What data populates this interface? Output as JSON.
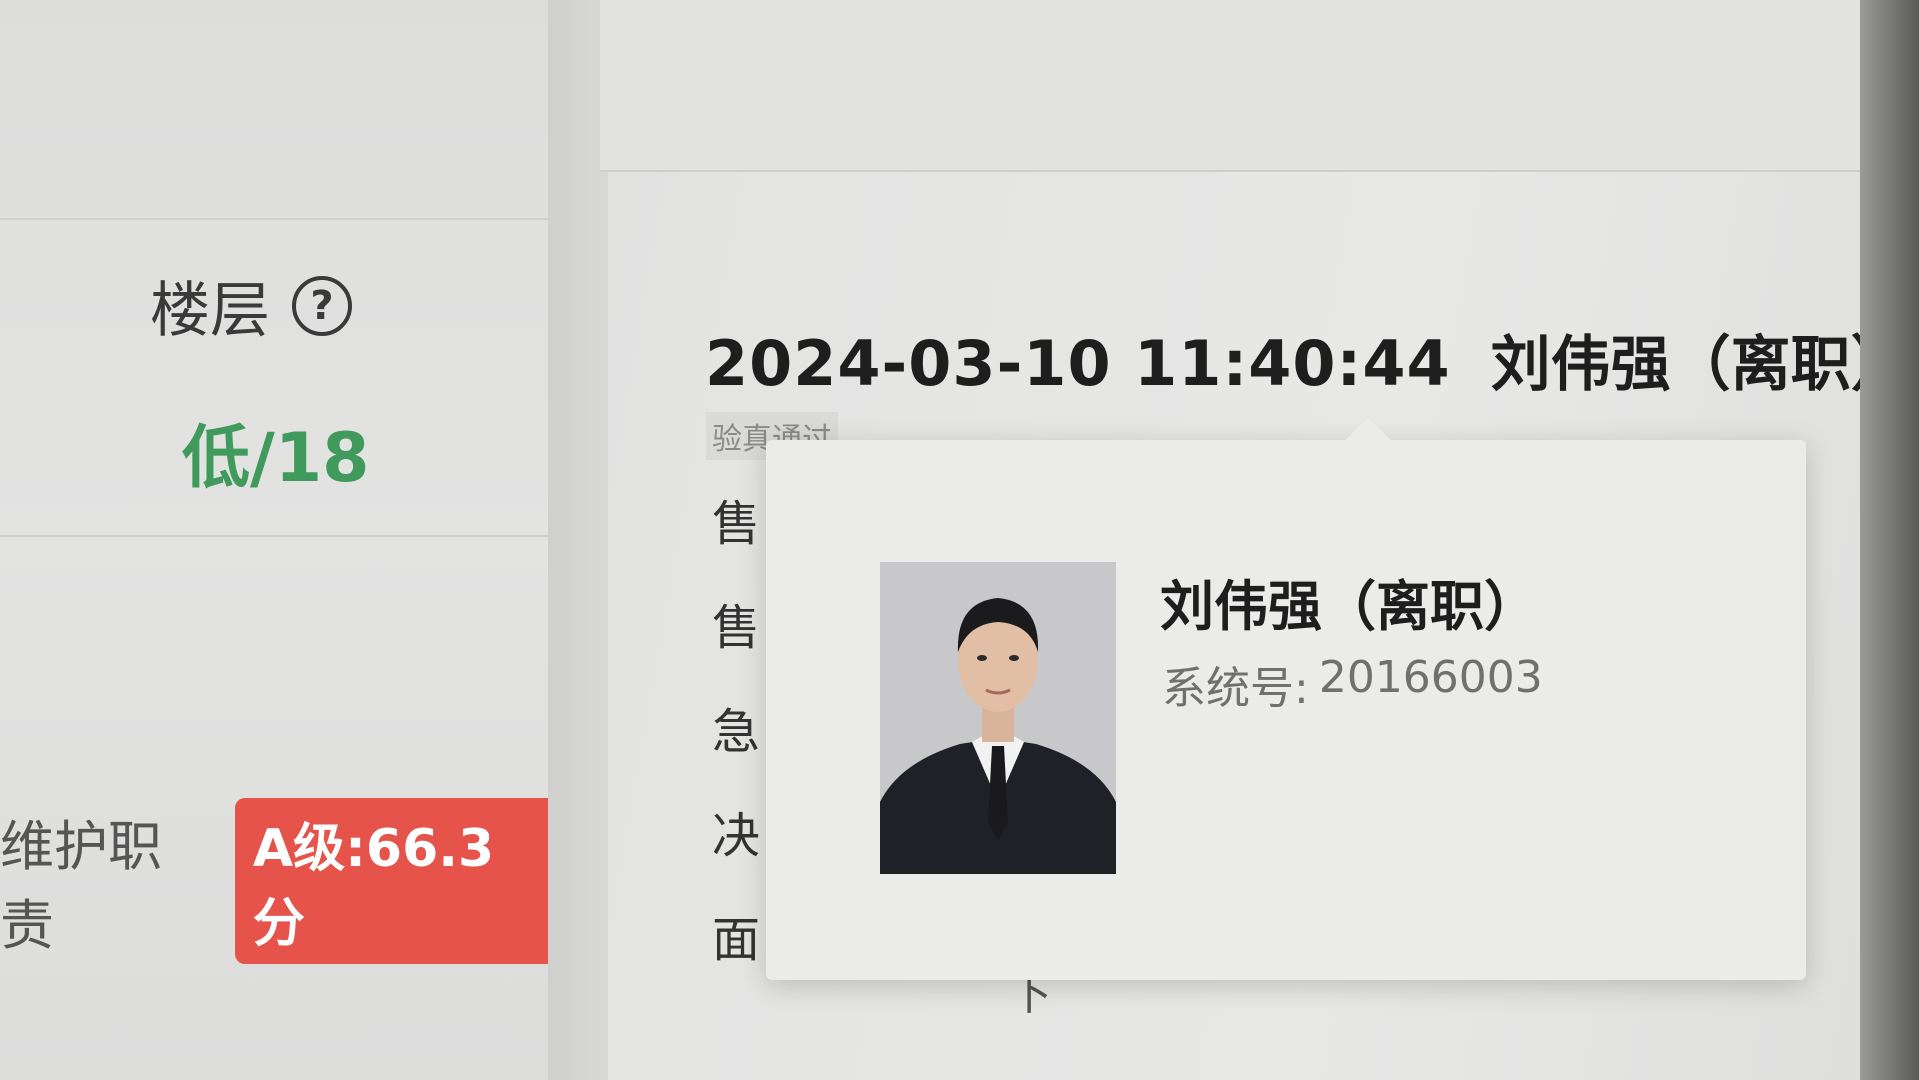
{
  "left": {
    "floor_label": "楼层",
    "help_icon": "?",
    "floor_value": "低/18",
    "duty_label": "维护职责",
    "grade_badge": "A级:66.3分"
  },
  "record": {
    "time": "2024-03-10 11:40:44",
    "person": "刘伟强（离职）",
    "verify_tag": "验真通过",
    "side_chars": [
      "售",
      "售",
      "急",
      "决",
      "面"
    ],
    "below_char": "下"
  },
  "card": {
    "name": "刘伟强（离职）",
    "id_label": "系统号:",
    "id_value": "20166003"
  },
  "colors": {
    "floor_value": "#3f9a5c",
    "grade_badge_bg": "#e5534b"
  },
  "icons": {
    "help": "question-circle-icon"
  }
}
